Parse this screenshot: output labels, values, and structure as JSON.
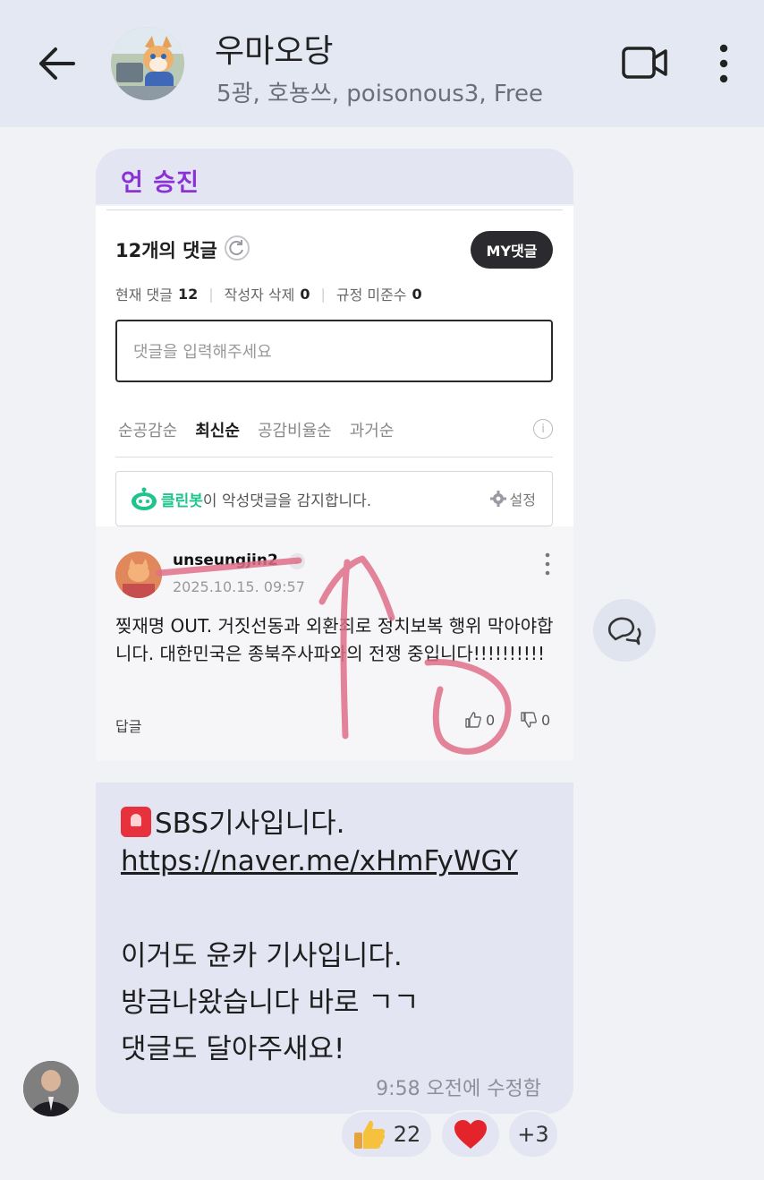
{
  "header": {
    "title": "우마오당",
    "members": "5광, 호뇽쓰, poisonous3, Free",
    "icons": [
      "back-arrow-icon",
      "video-call-icon",
      "more-vertical-icon"
    ]
  },
  "shared_post": {
    "sender": "언 승진",
    "comments_header": {
      "count_label": "12개의 댓글",
      "my_button": "MY댓글",
      "stats": {
        "current_label": "현재 댓글",
        "current_value": "12",
        "deleted_label": "작성자 삭제",
        "deleted_value": "0",
        "violation_label": "규정 미준수",
        "violation_value": "0"
      },
      "input_placeholder": "댓글을 입력해주세요",
      "sort_tabs": [
        {
          "label": "순공감순",
          "active": false
        },
        {
          "label": "최신순",
          "active": true
        },
        {
          "label": "공감비율순",
          "active": false
        },
        {
          "label": "과거순",
          "active": false
        }
      ],
      "cleanbot": {
        "name": "클린봇",
        "text": "이 악성댓글을 감지합니다.",
        "settings": "설정",
        "accent": "#1ec58a"
      }
    },
    "comment": {
      "username": "unseungjin2",
      "date": "2025.10.15. 09:57",
      "text": "찢재명 OUT. 거짓선동과 외환죄로 정치보복 행위 막아야합니다. 대한민국은 종북주사파와의 전쟁 중입니다!!!!!!!!!!",
      "reply": "답글",
      "likes": "0",
      "dislikes": "0"
    }
  },
  "message": {
    "line1": "SBS기사입니다.",
    "link": "https://naver.me/xHmFyWGY",
    "line2": "이거도 윤카 기사입니다.",
    "line3": "방금나왔습니다 바로 ㄱㄱ",
    "line4": "댓글도 달아주새요!",
    "time": "9:58 오전에 수정함"
  },
  "reactions": [
    {
      "icon": "thumbs-up-emoji",
      "count": "22"
    },
    {
      "icon": "red-heart-emoji",
      "count": ""
    },
    {
      "icon": "more-reactions",
      "count": "+3"
    }
  ],
  "colors": {
    "header_bg": "#e4e8f3",
    "bubble_bg": "#e3e6f2",
    "sender_name": "#8a32d8",
    "annotation_red": "#e0708a"
  }
}
